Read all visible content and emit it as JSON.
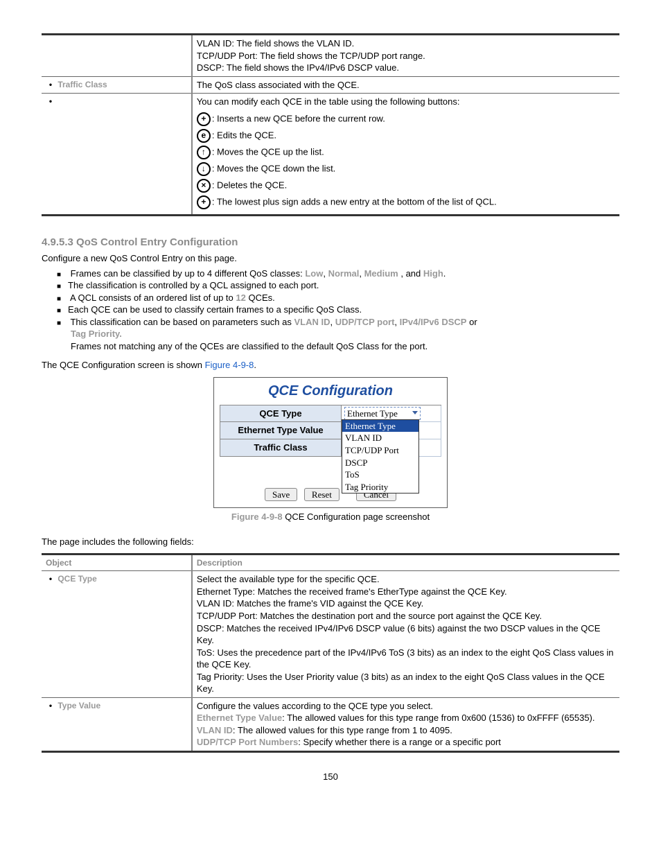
{
  "table1": {
    "row0": {
      "l1": "VLAN ID: The field shows the VLAN ID.",
      "l2": "TCP/UDP Port: The field shows the TCP/UDP port range.",
      "l3": "DSCP: The field shows the IPv4/IPv6 DSCP value."
    },
    "row1": {
      "label": "Traffic Class",
      "desc": "The QoS class associated with the QCE."
    },
    "row2": {
      "intro": "You can modify each QCE in the table using the following buttons:",
      "a": ": Inserts a new QCE before the current row.",
      "b": ": Edits the QCE.",
      "c": ": Moves the QCE up the list.",
      "d": ": Moves the QCE down the list.",
      "e": ": Deletes the QCE.",
      "f": ": The lowest plus sign adds a new entry at the bottom of the list of QCL."
    }
  },
  "section": {
    "heading": "4.9.5.3 QoS Control Entry Configuration",
    "intro": "Configure a new QoS Control Entry on this page.",
    "b1a": "Frames can be classified by up to 4 different QoS classes: ",
    "b1_low": "Low",
    "b1_n": "Normal",
    "b1_m": "Medium",
    "b1_h": "High",
    "b1_and": ", and ",
    "b2": "The classification is controlled by a QCL assigned to each port.",
    "b3a": "A QCL consists of an ordered list of up to ",
    "b3_12": "12",
    "b3b": " QCEs.",
    "b4": "Each QCE can be used to classify certain frames to a specific QoS Class.",
    "b5a": "This classification can be based on parameters such as ",
    "b5_vlan": "VLAN ID",
    "b5_udp": "UDP/TCP port",
    "b5_dscp": "IPv4/IPv6 DSCP",
    "b5_or": " or",
    "b5_tag": "Tag Priority.",
    "b5_rest": " Frames not matching any of the QCEs are classified to the default QoS Class for the port.",
    "leadin": "The QCE Configuration screen is shown ",
    "figref": "Figure 4-9-8",
    "caption_pre": "Figure 4-9-8 ",
    "caption": "QCE Configuration page screenshot",
    "fieldsintro": "The page includes the following fields:"
  },
  "qce": {
    "title": "QCE Configuration",
    "lab1": "QCE Type",
    "lab2": "Ethernet Type Value",
    "lab3": "Traffic Class",
    "selected": "Ethernet Type",
    "opts": [
      "Ethernet Type",
      "VLAN ID",
      "TCP/UDP Port",
      "DSCP",
      "ToS",
      "Tag Priority"
    ],
    "save": "Save",
    "reset": "Reset",
    "cancel": "Cancel"
  },
  "table2": {
    "head_l": "Object",
    "head_r": "Description",
    "r1": {
      "label": "QCE Type",
      "l0": "Select the available type for the specific QCE.",
      "l1": "Ethernet Type: Matches the received frame's EtherType against the QCE Key.",
      "l2": "VLAN ID: Matches the frame's VID against the QCE Key.",
      "l3": "TCP/UDP Port: Matches the destination port and the source port against the QCE Key.",
      "l4": "DSCP: Matches the received IPv4/IPv6 DSCP value (6 bits) against the two DSCP values in the QCE Key.",
      "l5": "ToS: Uses the precedence part of the IPv4/IPv6 ToS (3 bits) as an index to the eight QoS Class values in the QCE Key.",
      "l6": "Tag Priority: Uses the User Priority value (3 bits) as an index to the eight QoS Class values in the QCE Key."
    },
    "r2": {
      "label": "Type Value",
      "l0": "Configure the values according to the QCE type you select.",
      "eth_b": "Ethernet Type Value",
      "eth": ": The allowed values for this type range from 0x600 (1536) to 0xFFFF (65535).",
      "vlan_b": "VLAN ID",
      "vlan": ": The allowed values for this type range from 1 to 4095.",
      "udp_b": "UDP/TCP Port Numbers",
      "udp": ": Specify whether there is a range or a specific port"
    }
  },
  "pageno": "150"
}
